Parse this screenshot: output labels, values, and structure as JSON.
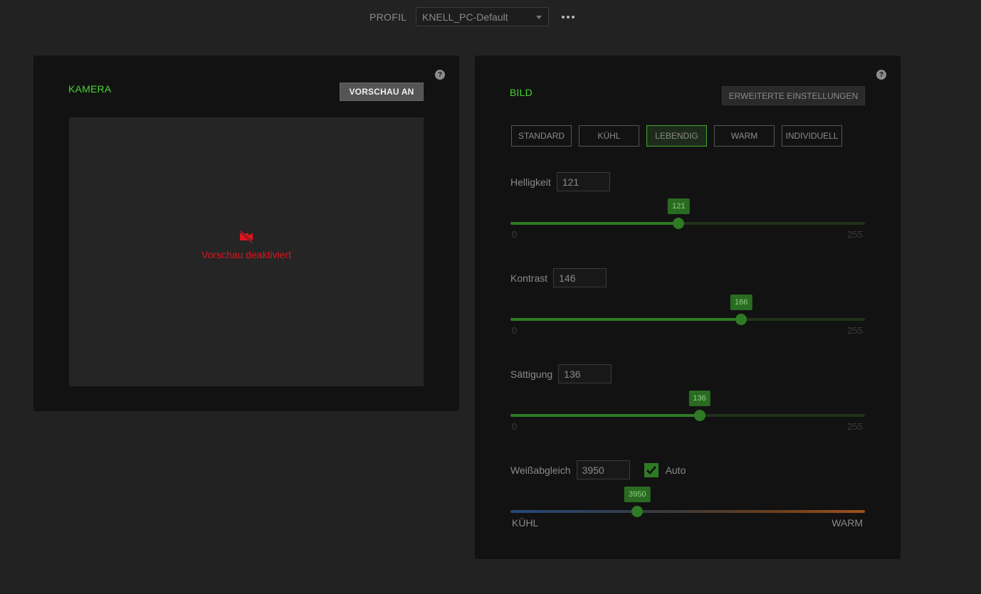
{
  "profile": {
    "label": "PROFIL",
    "selected": "KNELL_PC-Default"
  },
  "camera": {
    "title": "KAMERA",
    "preview_button": "VORSCHAU AN",
    "preview_message": "Vorschau deaktiviert",
    "help": "?"
  },
  "image": {
    "title": "BILD",
    "advanced_button": "ERWEITERTE EINSTELLUNGEN",
    "help": "?",
    "presets": [
      "STANDARD",
      "KÜHL",
      "LEBENDIG",
      "WARM",
      "INDIVIDUELL"
    ],
    "active_preset": "LEBENDIG",
    "brightness": {
      "label": "Helligkeit",
      "value": "121",
      "tip": "121",
      "min": "0",
      "max": "255",
      "level": 121
    },
    "contrast": {
      "label": "Kontrast",
      "value": "146",
      "tip": "166",
      "min": "0",
      "max": "255",
      "level": 166
    },
    "saturation": {
      "label": "Sättigung",
      "value": "136",
      "tip": "136",
      "min": "0",
      "max": "255",
      "level": 136
    },
    "white_balance": {
      "label": "Weißabgleich",
      "value": "3950",
      "tip": "3950",
      "auto_label": "Auto",
      "auto_checked": true,
      "min_label": "KÜHL",
      "max_label": "WARM",
      "level_fraction": 0.358
    }
  },
  "colors": {
    "accent_green": "#44d62c",
    "error_red": "#e0141e"
  }
}
